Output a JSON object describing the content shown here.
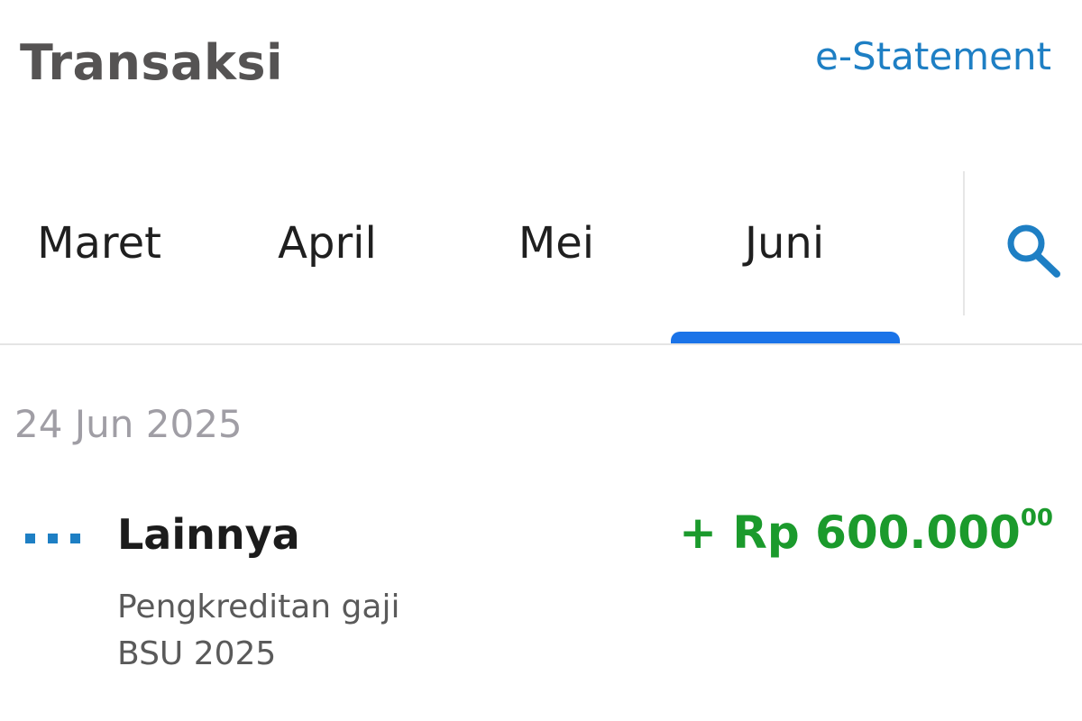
{
  "header": {
    "title": "Transaksi",
    "estatement_label": "e-Statement"
  },
  "tabs": {
    "items": [
      {
        "label": "Maret"
      },
      {
        "label": "April"
      },
      {
        "label": "Mei"
      },
      {
        "label": "Juni"
      }
    ],
    "selected": "Juni",
    "accent_color": "#1a73e8"
  },
  "search": {
    "icon": "search-icon"
  },
  "transactions": {
    "groups": [
      {
        "date": "24 Jun 2025",
        "items": [
          {
            "icon": "more-icon",
            "category": "Lainnya",
            "desc_line1": "Pengkreditan gaji",
            "desc_line2": "BSU 2025",
            "amount_main": "+ Rp 600.000",
            "amount_cents": "00",
            "amount_color": "#1b9a2c"
          }
        ]
      }
    ]
  }
}
